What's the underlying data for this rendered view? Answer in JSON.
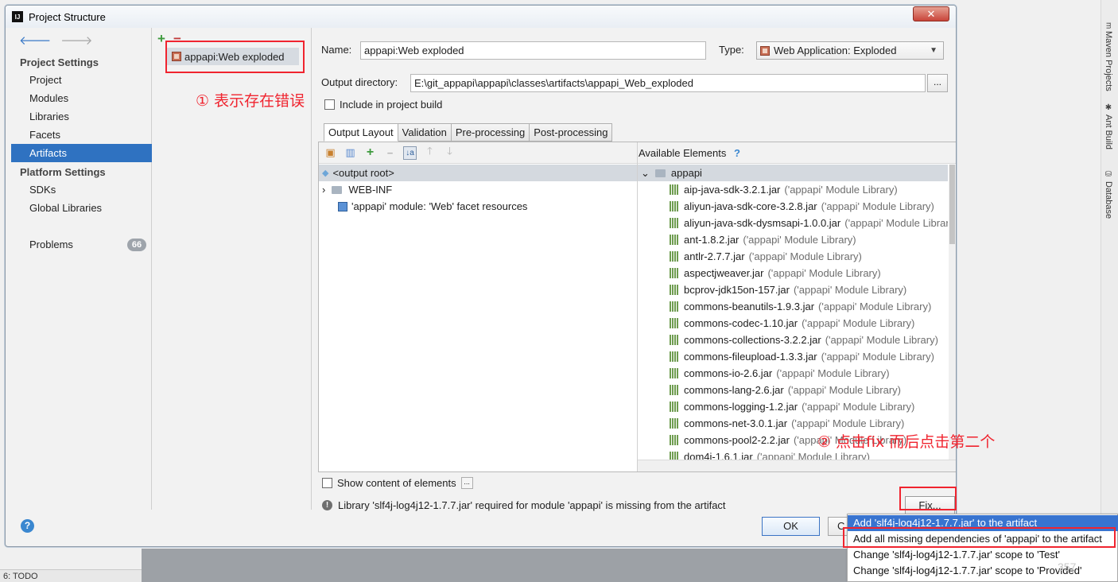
{
  "window": {
    "title": "Project Structure",
    "logo": "IJ",
    "close_glyph": "✕"
  },
  "nav": {
    "back_glyph": "🡐",
    "forward_glyph": "🡒",
    "project_settings_header": "Project Settings",
    "project_settings_items": [
      "Project",
      "Modules",
      "Libraries",
      "Facets",
      "Artifacts"
    ],
    "selected_item": "Artifacts",
    "platform_settings_header": "Platform Settings",
    "platform_settings_items": [
      "SDKs",
      "Global Libraries"
    ],
    "problems_label": "Problems",
    "problems_count": "66"
  },
  "artifacts": {
    "add_glyph": "+",
    "remove_glyph": "−",
    "items": [
      "appapi:Web exploded"
    ]
  },
  "form": {
    "name_label": "Name:",
    "name_value": "appapi:Web exploded",
    "type_label": "Type:",
    "type_value": "Web Application: Exploded",
    "output_dir_label": "Output directory:",
    "output_dir_value": "E:\\git_appapi\\appapi\\classes\\artifacts\\appapi_Web_exploded",
    "browse_label": "...",
    "include_build_label": "Include in project build"
  },
  "tabs": [
    "Output Layout",
    "Validation",
    "Pre-processing",
    "Post-processing"
  ],
  "active_tab": "Output Layout",
  "layout_toolbar": {
    "icons": [
      "create-folder-icon",
      "archive-icon",
      "add-icon",
      "remove-icon",
      "sort-icon",
      "move-up-icon",
      "move-down-icon"
    ],
    "add_glyph": "+",
    "remove_glyph": "−",
    "sort_glyph": "↓a",
    "up_glyph": "🡑",
    "down_glyph": "🡓"
  },
  "output_tree": {
    "root": "<output root>",
    "children": [
      "WEB-INF",
      "'appapi' module: 'Web' facet resources"
    ]
  },
  "available": {
    "header": "Available Elements",
    "help_glyph": "?",
    "root": "appapi",
    "libraries": [
      {
        "name": "aip-java-sdk-3.2.1.jar",
        "desc": "('appapi' Module Library)"
      },
      {
        "name": "aliyun-java-sdk-core-3.2.8.jar",
        "desc": "('appapi' Module Library)"
      },
      {
        "name": "aliyun-java-sdk-dysmsapi-1.0.0.jar",
        "desc": "('appapi' Module Library)"
      },
      {
        "name": "ant-1.8.2.jar",
        "desc": "('appapi' Module Library)"
      },
      {
        "name": "antlr-2.7.7.jar",
        "desc": "('appapi' Module Library)"
      },
      {
        "name": "aspectjweaver.jar",
        "desc": "('appapi' Module Library)"
      },
      {
        "name": "bcprov-jdk15on-157.jar",
        "desc": "('appapi' Module Library)"
      },
      {
        "name": "commons-beanutils-1.9.3.jar",
        "desc": "('appapi' Module Library)"
      },
      {
        "name": "commons-codec-1.10.jar",
        "desc": "('appapi' Module Library)"
      },
      {
        "name": "commons-collections-3.2.2.jar",
        "desc": "('appapi' Module Library)"
      },
      {
        "name": "commons-fileupload-1.3.3.jar",
        "desc": "('appapi' Module Library)"
      },
      {
        "name": "commons-io-2.6.jar",
        "desc": "('appapi' Module Library)"
      },
      {
        "name": "commons-lang-2.6.jar",
        "desc": "('appapi' Module Library)"
      },
      {
        "name": "commons-logging-1.2.jar",
        "desc": "('appapi' Module Library)"
      },
      {
        "name": "commons-net-3.0.1.jar",
        "desc": "('appapi' Module Library)"
      },
      {
        "name": "commons-pool2-2.2.jar",
        "desc": "('appapi' Module Library)"
      },
      {
        "name": "dom4j-1.6.1.jar",
        "desc": "('appapi' Module Library)"
      }
    ]
  },
  "show_content_label": "Show content of elements",
  "show_content_btn": "...",
  "status": {
    "warning_glyph": "!",
    "message": "Library 'slf4j-log4j12-1.7.7.jar' required for module 'appapi' is missing from the artifact"
  },
  "buttons": {
    "fix": "Fix...",
    "ok": "OK",
    "cancel": "C",
    "help": "?"
  },
  "fix_popup": {
    "items": [
      "Add 'slf4j-log4j12-1.7.7.jar' to the artifact",
      "Add all missing dependencies of 'appapi' to the artifact",
      "Change 'slf4j-log4j12-1.7.7.jar' scope to 'Test'",
      "Change 'slf4j-log4j12-1.7.7.jar' scope to 'Provided'"
    ],
    "highlighted_index": 0
  },
  "annotations": {
    "note1": "① 表示存在错误",
    "note2": "② 点击fix  而后点击第二个",
    "accent_color": "#f0242f"
  },
  "side_tools": {
    "maven_label": "Maven Projects",
    "maven_glyph": "m",
    "ant_label": "Ant Build",
    "ant_glyph": "✱",
    "database_label": "Database",
    "database_glyph": "⛁"
  },
  "bottom": {
    "todo_label": "6: TODO",
    "watermark": "357"
  }
}
